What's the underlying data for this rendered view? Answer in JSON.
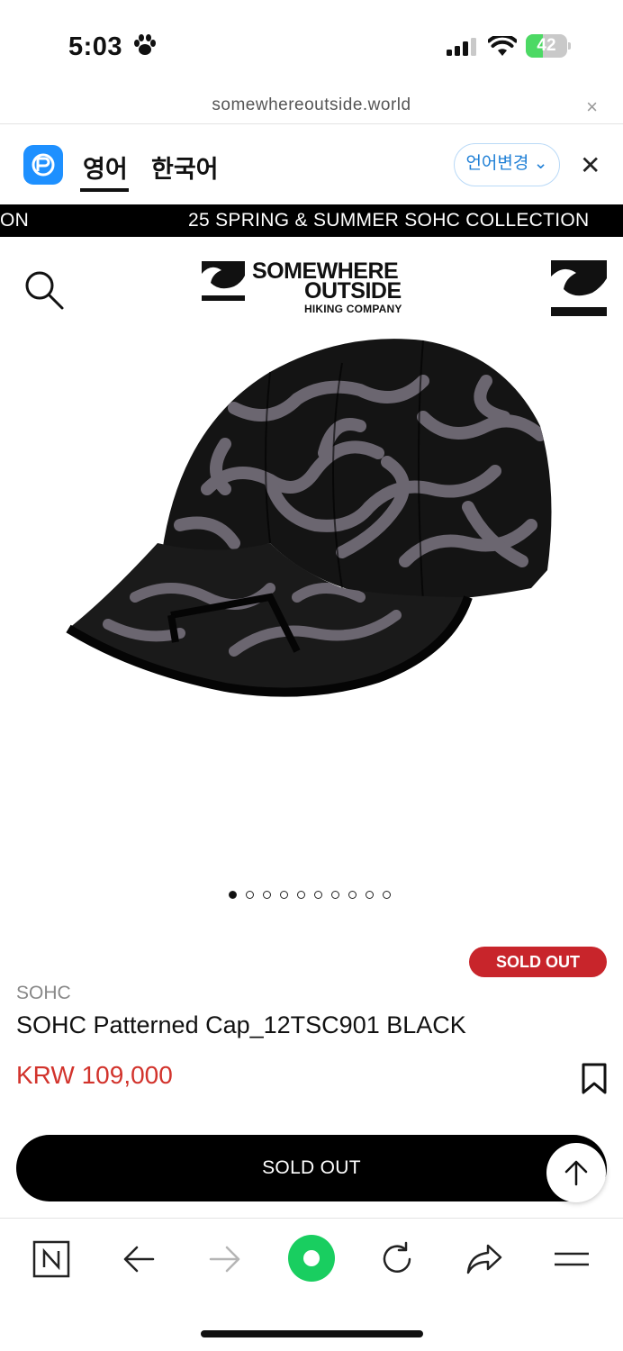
{
  "status_bar": {
    "time": "5:03",
    "battery": "42",
    "battery_level": 0.42
  },
  "browser": {
    "url": "somewhereoutside.world",
    "close_label": "×"
  },
  "translate_bar": {
    "lang_source": "영어",
    "lang_target": "한국어",
    "change_label": "언어변경 ⌄",
    "close_label": "✕"
  },
  "marquee": {
    "left_text": "ON",
    "main_text": "25 SPRING & SUMMER SOHC COLLECTION"
  },
  "logo": {
    "line1": "SOMEWHERE",
    "line2": "OUTSIDE",
    "line3": "HIKING COMPANY"
  },
  "gallery": {
    "total": 10,
    "active_index": 0
  },
  "product": {
    "badge": "SOLD OUT",
    "brand": "SOHC",
    "name": "SOHC Patterned Cap_12TSC901 BLACK",
    "price": "KRW 109,000",
    "button_label": "SOLD OUT"
  },
  "colors": {
    "accent_red": "#c8252b",
    "price_red": "#d2332c",
    "link_blue": "#1e7fd6",
    "naver_green": "#19ce60"
  },
  "icons": [
    "paw-icon",
    "signal-icon",
    "wifi-icon",
    "search-icon",
    "bookmark-icon",
    "arrow-up-icon",
    "naver-icon",
    "back-icon",
    "forward-icon",
    "reload-icon",
    "share-icon",
    "menu-icon"
  ]
}
